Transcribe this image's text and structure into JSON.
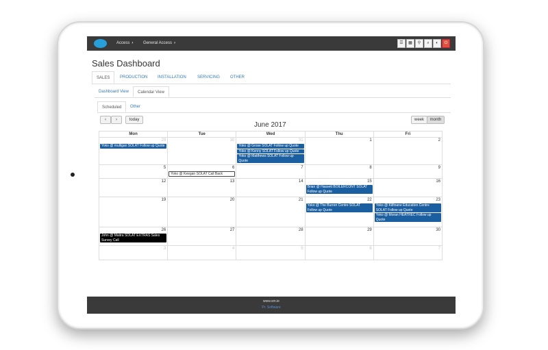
{
  "breadcrumbs": [
    "Access",
    "General Access"
  ],
  "toolbar_icons": [
    "menu-icon",
    "grid-icon",
    "pin-icon",
    "search-icon",
    "contrast-icon",
    "power-icon"
  ],
  "page_title": "Sales Dashboard",
  "main_tabs": [
    {
      "label": "SALES",
      "active": true
    },
    {
      "label": "PRODUCTION",
      "active": false
    },
    {
      "label": "INSTALLATION",
      "active": false
    },
    {
      "label": "SERVICING",
      "active": false
    },
    {
      "label": "OTHER",
      "active": false
    }
  ],
  "view_tabs": [
    {
      "label": "Dashboard View",
      "active": false
    },
    {
      "label": "Calendar View",
      "active": true
    }
  ],
  "schedule_tabs": [
    {
      "label": "Scheduled",
      "active": true
    },
    {
      "label": "Other",
      "active": false
    }
  ],
  "calendar": {
    "prev_label": "‹",
    "next_label": "›",
    "today_label": "today",
    "week_label": "week",
    "month_label": "month",
    "title": "June 2017",
    "day_headers": [
      "Mon",
      "Tue",
      "Wed",
      "Thu",
      "Fri"
    ],
    "weeks": [
      {
        "days": [
          {
            "num": "29",
            "other": true,
            "events": [
              {
                "text": "Yoko @ mulligan SOLAT Follow up Quote",
                "style": "blue"
              }
            ]
          },
          {
            "num": "30",
            "other": true,
            "events": []
          },
          {
            "num": "31",
            "other": true,
            "events": [
              {
                "text": "Yoko @ Grose SOLAT Follow up Quote",
                "style": "blue"
              },
              {
                "text": "Yoko @ Kenny SOLAT Follow up Quote",
                "style": "blue"
              },
              {
                "text": "Yoko @ Matthews SOLAT Follow up Quote",
                "style": "blue"
              }
            ]
          },
          {
            "num": "1",
            "other": false,
            "events": []
          },
          {
            "num": "2",
            "other": false,
            "events": []
          }
        ]
      },
      {
        "days": [
          {
            "num": "5",
            "other": false,
            "events": []
          },
          {
            "num": "6",
            "other": false,
            "events": [
              {
                "text": "Yoko @ Keegan SOLAT Call Back",
                "style": "white"
              }
            ]
          },
          {
            "num": "7",
            "other": false,
            "events": []
          },
          {
            "num": "8",
            "other": false,
            "events": []
          },
          {
            "num": "9",
            "other": false,
            "events": []
          }
        ]
      },
      {
        "days": [
          {
            "num": "12",
            "other": false,
            "events": []
          },
          {
            "num": "13",
            "other": false,
            "events": []
          },
          {
            "num": "14",
            "other": false,
            "events": []
          },
          {
            "num": "15",
            "other": false,
            "events": [
              {
                "text": "Brian @ Hassett BOILERCONT SOLAT Follow up Quote",
                "style": "blue"
              }
            ]
          },
          {
            "num": "16",
            "other": false,
            "events": []
          }
        ]
      },
      {
        "days": [
          {
            "num": "19",
            "other": false,
            "events": []
          },
          {
            "num": "20",
            "other": false,
            "events": []
          },
          {
            "num": "21",
            "other": false,
            "events": []
          },
          {
            "num": "22",
            "other": false,
            "events": [
              {
                "text": "Yoko @ The Burren Centre SOLAT Follow up Quote",
                "style": "blue"
              }
            ]
          },
          {
            "num": "23",
            "other": false,
            "events": [
              {
                "text": "Yoko @ Kilfinane Education Centre SOLAT Follow up Quote",
                "style": "blue"
              },
              {
                "text": "Yoko @ Moran HEATREC Follow up Quote",
                "style": "blue"
              }
            ]
          }
        ]
      },
      {
        "days": [
          {
            "num": "26",
            "other": false,
            "events": [
              {
                "text": "John @ Maitra SOLAT EXTRAS Sales Survey Call",
                "style": "black"
              }
            ]
          },
          {
            "num": "27",
            "other": false,
            "events": []
          },
          {
            "num": "28",
            "other": false,
            "events": []
          },
          {
            "num": "29",
            "other": false,
            "events": []
          },
          {
            "num": "30",
            "other": false,
            "events": []
          }
        ]
      },
      {
        "days": [
          {
            "num": "3",
            "other": true,
            "events": []
          },
          {
            "num": "4",
            "other": true,
            "events": []
          },
          {
            "num": "5",
            "other": true,
            "events": []
          },
          {
            "num": "6",
            "other": true,
            "events": []
          },
          {
            "num": "7",
            "other": true,
            "events": []
          }
        ]
      }
    ]
  },
  "footer": {
    "line1": "www.sm.ie",
    "line2": "Pr. Software"
  }
}
